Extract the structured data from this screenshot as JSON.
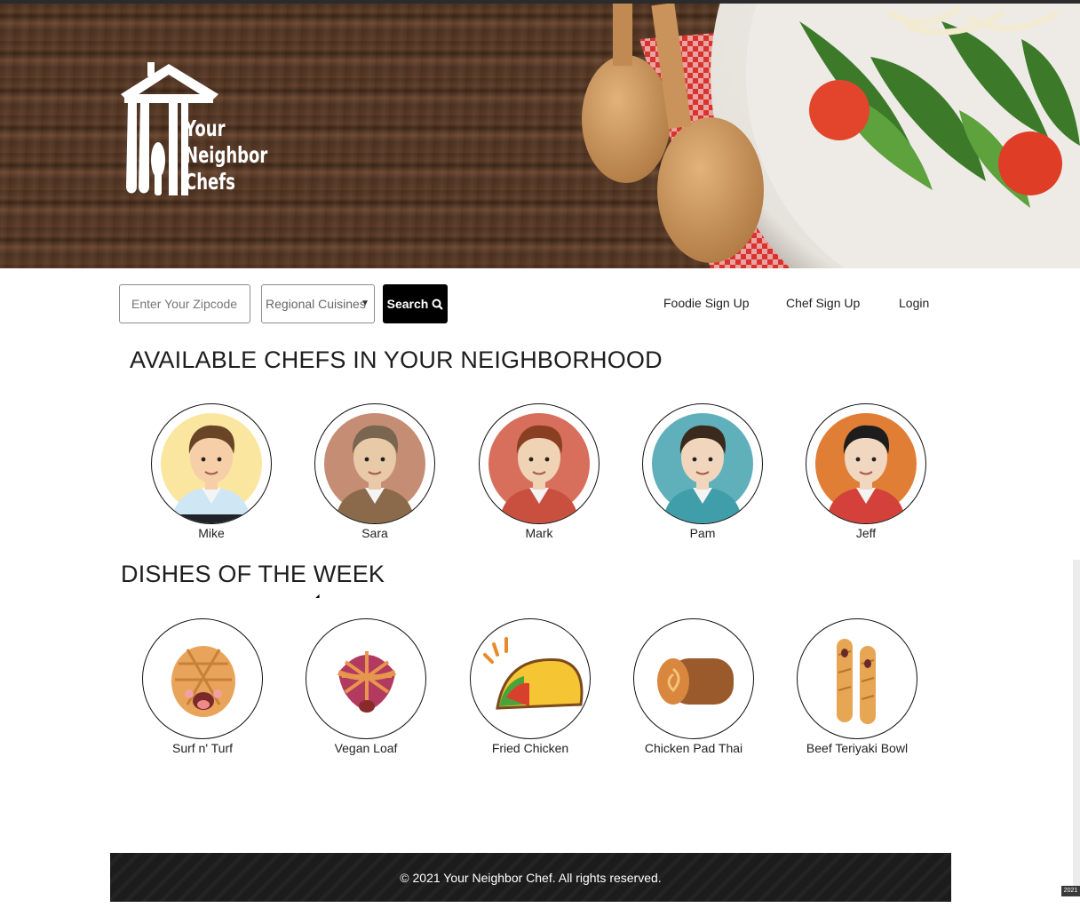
{
  "brand": {
    "logo_lines": [
      "Your",
      "Neighbor",
      "Chefs"
    ]
  },
  "search": {
    "zip_placeholder": "Enter Your Zipcode",
    "cuisine_selected": "Regional Cuisines",
    "button_label": "Search"
  },
  "nav": {
    "foodie_signup": "Foodie Sign Up",
    "chef_signup": "Chef Sign Up",
    "login": "Login"
  },
  "chefs_section": {
    "title": "AVAILABLE CHEFS IN YOUR NEIGHBORHOOD",
    "chefs": [
      {
        "name": "Mike",
        "bg": "#fbe6a0",
        "shirt": "#cfe6f5",
        "hair": "#6a4427",
        "skin": "#f6cfa9"
      },
      {
        "name": "Sara",
        "bg": "#c58d74",
        "shirt": "#8a6a4b",
        "hair": "#7a6550",
        "skin": "#e8c9a8"
      },
      {
        "name": "Mark",
        "bg": "#d86f5c",
        "shirt": "#c9503f",
        "hair": "#8a3f22",
        "skin": "#f0d2b5"
      },
      {
        "name": "Pam",
        "bg": "#5fb0bb",
        "shirt": "#3f9eaa",
        "hair": "#3a2a1e",
        "skin": "#f1d6bd"
      },
      {
        "name": "Jeff",
        "bg": "#e07e35",
        "shirt": "#d3413a",
        "hair": "#1d1d1d",
        "skin": "#f1d7bf"
      }
    ]
  },
  "dishes_section": {
    "title": "DISHES OF THE WEEK",
    "dishes": [
      {
        "name": "Surf n' Turf",
        "icon": "bread-bun-icon"
      },
      {
        "name": "Vegan Loaf",
        "icon": "pie-icon"
      },
      {
        "name": "Fried Chicken",
        "icon": "taco-icon"
      },
      {
        "name": "Chicken Pad Thai",
        "icon": "roll-cake-icon"
      },
      {
        "name": "Beef Teriyaki Bowl",
        "icon": "baguette-icon"
      }
    ]
  },
  "footer": {
    "copyright": "© 2021 Your Neighbor Chef. All rights reserved."
  },
  "corner_badge": "2021"
}
